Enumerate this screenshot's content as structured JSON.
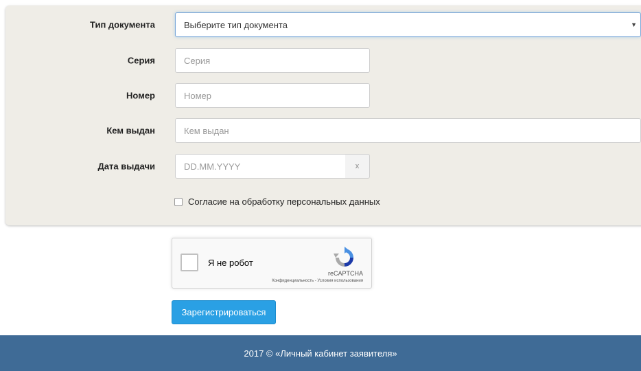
{
  "form": {
    "doc_type": {
      "label": "Тип документа",
      "value": "Выберите тип документа"
    },
    "series": {
      "label": "Серия",
      "placeholder": "Серия"
    },
    "number": {
      "label": "Номер",
      "placeholder": "Номер"
    },
    "issued_by": {
      "label": "Кем выдан",
      "placeholder": "Кем выдан"
    },
    "issue_date": {
      "label": "Дата выдачи",
      "placeholder": "DD.MM.YYYY",
      "clear_glyph": "x"
    },
    "consent_label": "Согласие на обработку персональных данных"
  },
  "captcha": {
    "label": "Я не робот",
    "brand": "reCAPTCHA",
    "links": "Конфиденциальность - Условия использования"
  },
  "submit_label": "Зарегистрироваться",
  "footer": {
    "text": "2017 © «Личный кабинет заявителя»"
  },
  "colors": {
    "panel": "#efede7",
    "button": "#2aa0e4",
    "footer": "#3f6b96"
  }
}
